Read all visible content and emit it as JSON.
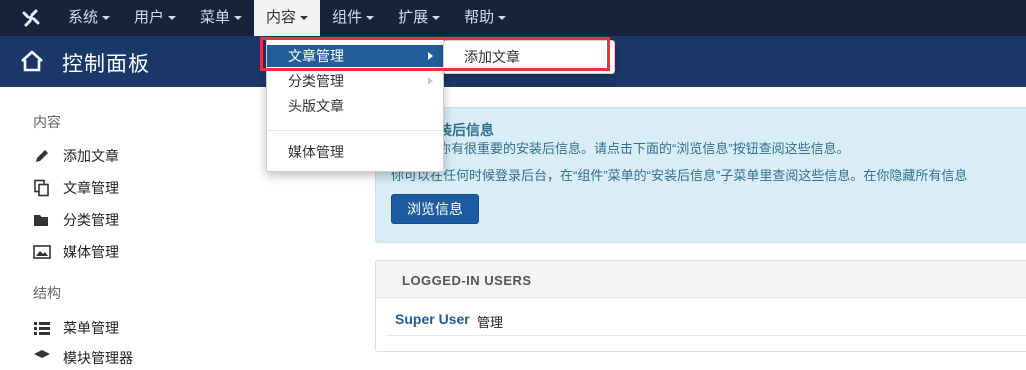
{
  "navbar": {
    "menus": [
      "系统",
      "用户",
      "菜单",
      "内容",
      "组件",
      "扩展",
      "帮助"
    ],
    "open_menu_index": 3
  },
  "header": {
    "title": "控制面板"
  },
  "sidebar": {
    "sections": [
      {
        "heading": "内容",
        "items": [
          {
            "label": "添加文章",
            "icon": "pencil-icon"
          },
          {
            "label": "文章管理",
            "icon": "copy-icon"
          },
          {
            "label": "分类管理",
            "icon": "folder-icon"
          },
          {
            "label": "媒体管理",
            "icon": "image-icon"
          }
        ]
      },
      {
        "heading": "结构",
        "items": [
          {
            "label": "菜单管理",
            "icon": "list-icon"
          },
          {
            "label": "模块管理器",
            "icon": "cube-icon"
          }
        ]
      }
    ]
  },
  "content_menu": {
    "items": [
      "文章管理",
      "分类管理",
      "头版文章",
      "媒体管理"
    ],
    "active_index": 0,
    "submenu": [
      "添加文章"
    ]
  },
  "post_install": {
    "title": "装后信息",
    "line1": "你有很重要的安装后信息。请点击下面的“浏览信息”按钮查阅这些信息。",
    "line2": "你可以在任何时候登录后台，在“组件”菜单的“安装后信息”子菜单里查阅这些信息。在你隐藏所有信息",
    "button": "浏览信息"
  },
  "logged_in": {
    "heading": "LOGGED-IN USERS",
    "users": [
      {
        "name": "Super User",
        "role": "管理"
      }
    ]
  },
  "colors": {
    "navbar": "#17233b",
    "titlebar": "#1a3867",
    "accent": "#1e5ca1",
    "highlight": "#e8333d"
  }
}
